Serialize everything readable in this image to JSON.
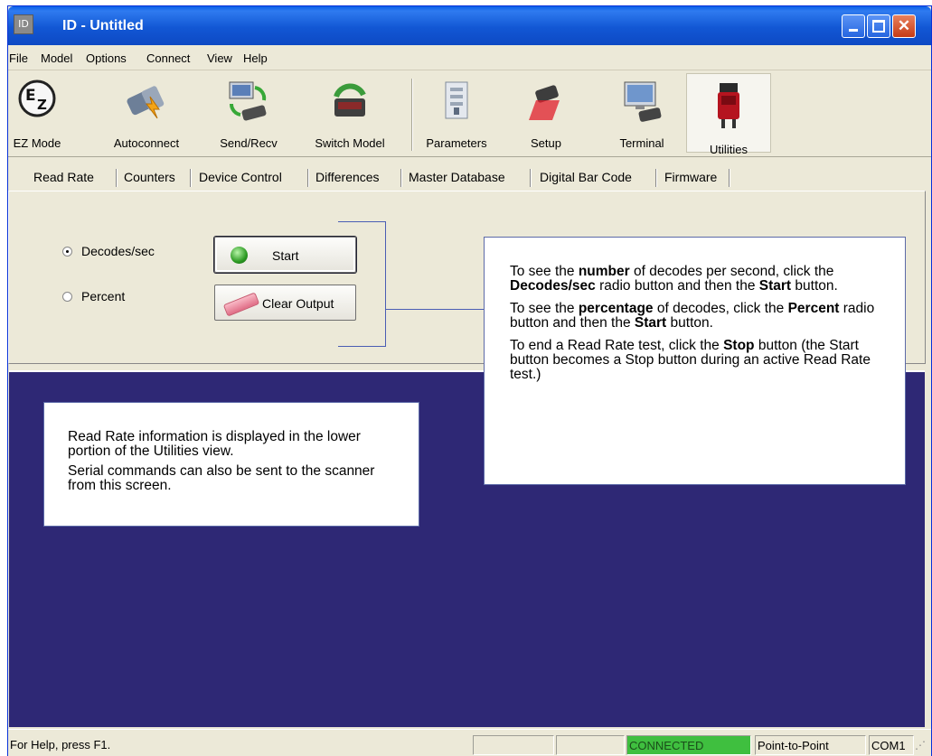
{
  "window": {
    "title": "ID - Untitled",
    "app_icon_text": "ID"
  },
  "menu": [
    "File",
    "Model",
    "Options",
    "Connect",
    "View",
    "Help"
  ],
  "toolbar": {
    "ez_mode": "EZ Mode",
    "autoconnect": "Autoconnect",
    "send_recv": "Send/Recv",
    "switch_model": "Switch Model",
    "parameters": "Parameters",
    "setup": "Setup",
    "terminal": "Terminal",
    "utilities": "Utilities"
  },
  "tabs": [
    "Read Rate",
    "Counters",
    "Device Control",
    "Differences",
    "Master Database",
    "Digital Bar Code",
    "Firmware"
  ],
  "read_rate": {
    "decodes_label": "Decodes/sec",
    "percent_label": "Percent",
    "decodes_selected": true,
    "start_label": "Start",
    "clear_label": "Clear Output"
  },
  "callout_right": {
    "p1": [
      "To see the ",
      "number",
      " of decodes per second, click the ",
      "Decodes/sec",
      " radio button and then the ",
      "Start",
      " button."
    ],
    "p2": [
      "To see the ",
      "percentage",
      " of decodes, click the ",
      "Percent",
      " radio button and then the ",
      "Start",
      " button."
    ],
    "p3": [
      "To end a Read Rate test, click the ",
      "Stop",
      " button (the Start button becomes a Stop button during an active Read Rate test.)"
    ]
  },
  "callout_left": {
    "p1": "Read Rate information is displayed in the lower portion of the Utilities view.",
    "p2": "Serial commands can also be sent to the scanner from this screen."
  },
  "status": {
    "help": "For Help, press F1.",
    "connected": "CONNECTED",
    "mode": "Point-to-Point",
    "port": "COM1"
  },
  "colors": {
    "output_bg": "#2e2875",
    "connected_bg": "#3fbf3f",
    "titlebar": "#1257d4"
  }
}
